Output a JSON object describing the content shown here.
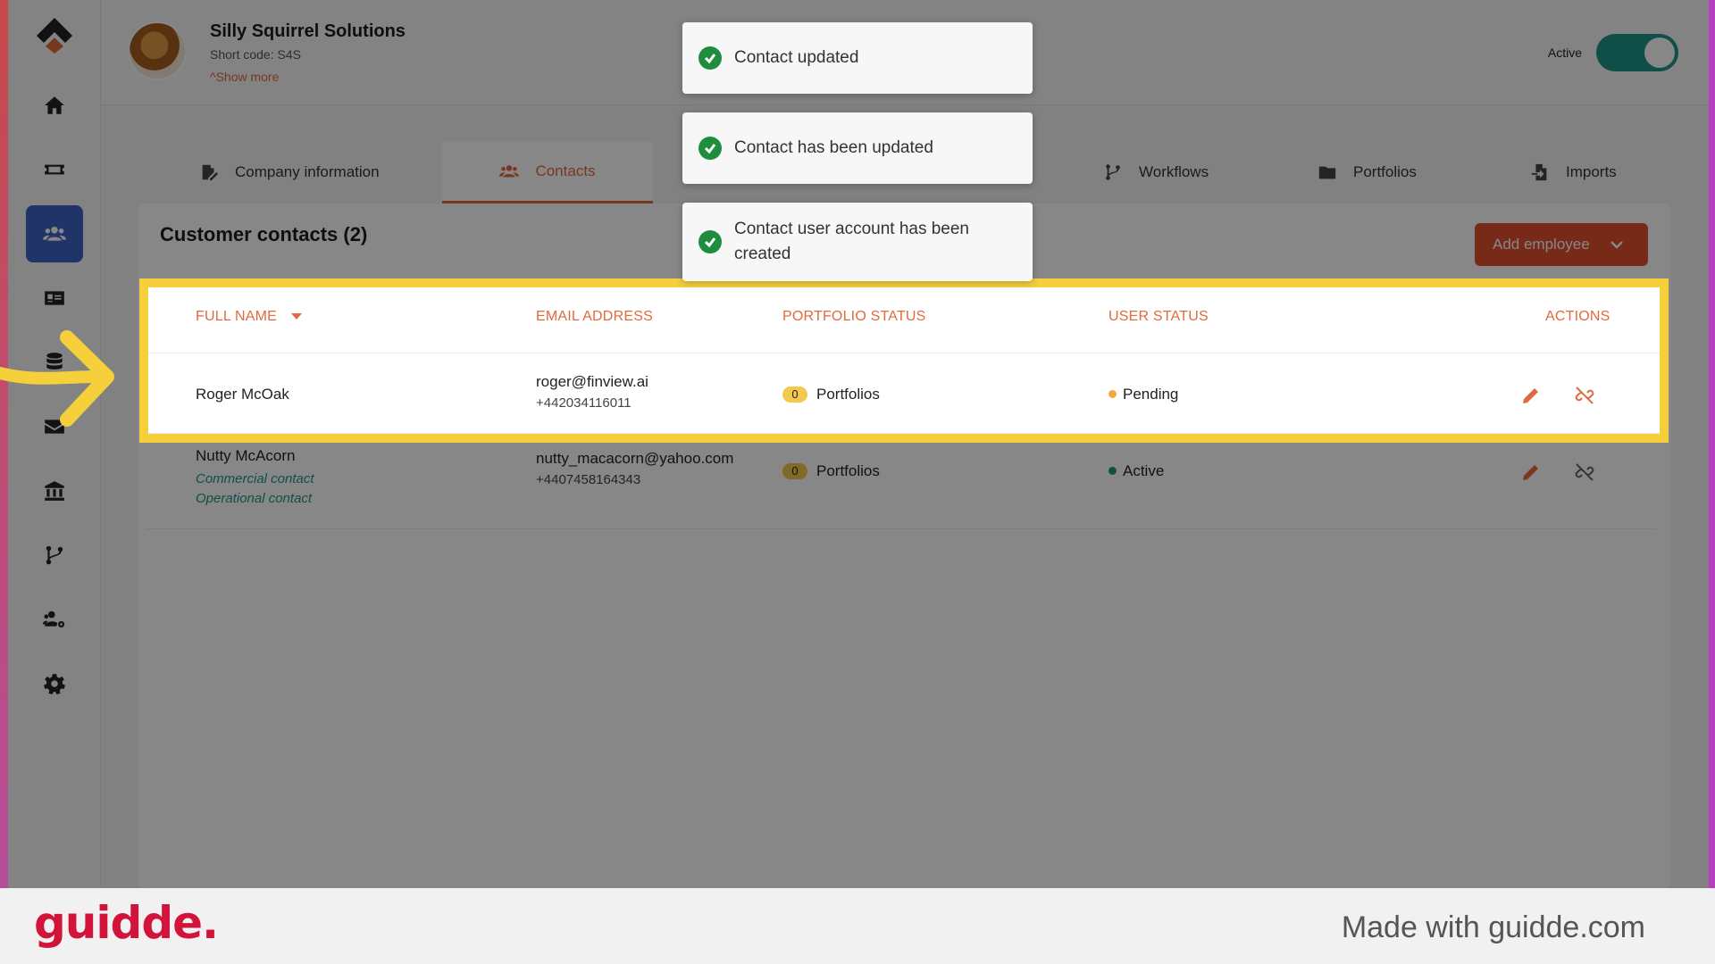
{
  "company": {
    "name": "Silly Squirrel Solutions",
    "short_code": "Short code: S4S",
    "show_more": "^Show more",
    "status_label": "Active"
  },
  "tabs": [
    {
      "label": "Company information",
      "icon": "edit-document-icon"
    },
    {
      "label": "Contacts",
      "icon": "users-icon",
      "active": true
    },
    {
      "label": "Workflows",
      "icon": "branch-icon"
    },
    {
      "label": "Portfolios",
      "icon": "folder-icon"
    },
    {
      "label": "Imports",
      "icon": "file-import-icon"
    }
  ],
  "panel": {
    "title": "Customer contacts (2)",
    "add_button": "Add employee"
  },
  "table": {
    "headers": [
      "FULL NAME",
      "EMAIL ADDRESS",
      "PORTFOLIO STATUS",
      "USER STATUS",
      "ACTIONS"
    ],
    "rows": [
      {
        "name": "Roger McOak",
        "email": "roger@finview.ai",
        "phone": "+442034116011",
        "portfolio_count": "0",
        "portfolio_label": "Portfolios",
        "status": "Pending",
        "status_color": "#f2a93b"
      },
      {
        "name": "Nutty McAcorn",
        "roles": [
          "Commercial contact",
          "Operational contact"
        ],
        "email": "nutty_macacorn@yahoo.com",
        "phone": "+4407458164343",
        "portfolio_count": "0",
        "portfolio_label": "Portfolios",
        "status": "Active",
        "status_color": "#1e9688"
      }
    ]
  },
  "toasts": [
    "Contact updated",
    "Contact has been updated",
    "Contact user account has been created"
  ],
  "footer": {
    "logo": "guidde.",
    "made_with": "Made with guidde.com"
  },
  "colors": {
    "accent": "#e06a3d",
    "primary": "#3d63c9",
    "success": "#1e8e3e",
    "highlight": "#f5d03b"
  }
}
